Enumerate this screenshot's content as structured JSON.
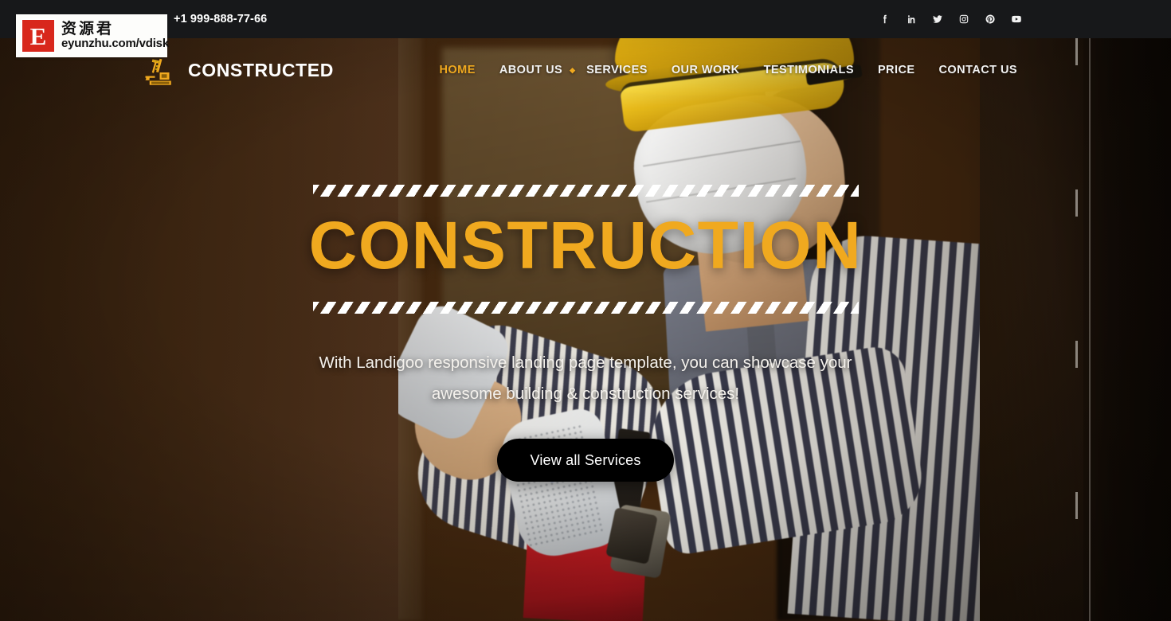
{
  "topbar": {
    "phone": "+1 999-888-77-66",
    "social": [
      {
        "name": "facebook-icon",
        "label": "Facebook"
      },
      {
        "name": "linkedin-icon",
        "label": "LinkedIn"
      },
      {
        "name": "twitter-icon",
        "label": "Twitter"
      },
      {
        "name": "instagram-icon",
        "label": "Instagram"
      },
      {
        "name": "pinterest-icon",
        "label": "Pinterest"
      },
      {
        "name": "youtube-icon",
        "label": "YouTube"
      }
    ]
  },
  "brand": {
    "name": "CONSTRUCTED",
    "icon": "crane-excavator-icon"
  },
  "nav": {
    "items": [
      {
        "label": "HOME",
        "active": true,
        "caret": false
      },
      {
        "label": "ABOUT US",
        "active": false,
        "caret": true
      },
      {
        "label": "SERVICES",
        "active": false,
        "caret": false
      },
      {
        "label": "OUR WORK",
        "active": false,
        "caret": false
      },
      {
        "label": "TESTIMONIALS",
        "active": false,
        "caret": false
      },
      {
        "label": "PRICE",
        "active": false,
        "caret": false
      },
      {
        "label": "CONTACT US",
        "active": false,
        "caret": false
      }
    ]
  },
  "hero": {
    "title": "CONSTRUCTION",
    "subtitle": "With Landigoo responsive landing page template, you can showcase your awesome building & construction services!",
    "button_label": "View all Services"
  },
  "watermark": {
    "letter": "E",
    "chinese": "资源君",
    "url": "eyunzhu.com/vdisk"
  },
  "colors": {
    "accent": "#f0a91f",
    "topbar_bg": "#17181a",
    "hero_bg": "#46290f",
    "button_bg": "#000000",
    "text_light": "#f4f1ec",
    "watermark_red": "#d8271c"
  }
}
